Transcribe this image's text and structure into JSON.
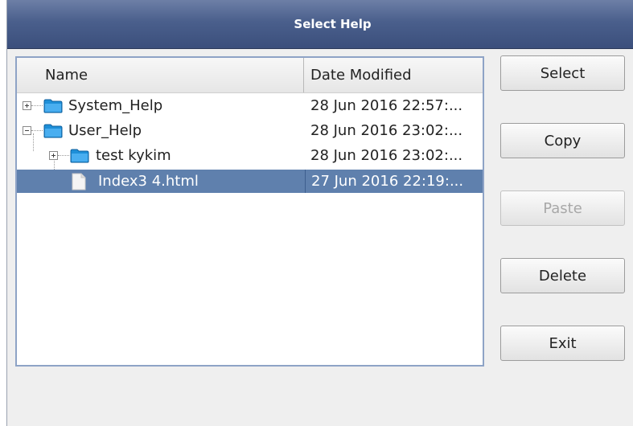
{
  "window": {
    "title": "Select Help"
  },
  "tree": {
    "columns": {
      "name": "Name",
      "date": "Date Modified"
    },
    "rows": [
      {
        "name": "System_Help",
        "date": "28 Jun 2016 22:57:...",
        "type": "folder",
        "expander": "plus",
        "selected": false
      },
      {
        "name": "User_Help",
        "date": "28 Jun 2016 23:02:...",
        "type": "folder",
        "expander": "minus",
        "selected": false
      },
      {
        "name": "test kykim",
        "date": "28 Jun 2016 23:02:...",
        "type": "folder",
        "expander": "plus",
        "selected": false
      },
      {
        "name": "Index3 4.html",
        "date": "27 Jun 2016 22:19:...",
        "type": "file",
        "expander": "none",
        "selected": true
      }
    ]
  },
  "buttons": {
    "select": "Select",
    "copy": "Copy",
    "paste": "Paste",
    "delete": "Delete",
    "exit": "Exit"
  },
  "colors": {
    "titlebar": "#4a5f8c",
    "selection": "#5f80ad",
    "folder": "#1e8fd8"
  },
  "icons": [
    "folder-icon",
    "file-icon",
    "expand-plus-icon",
    "collapse-minus-icon"
  ]
}
